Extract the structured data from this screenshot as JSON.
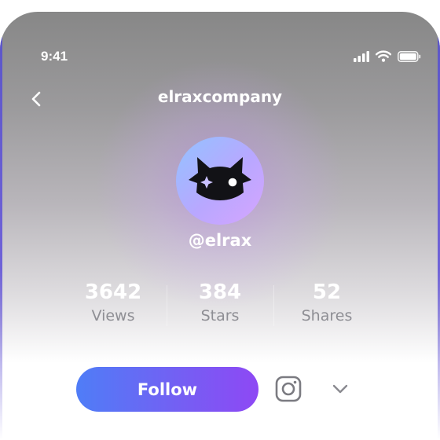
{
  "status_bar": {
    "time": "9:41"
  },
  "header": {
    "title": "elraxcompany"
  },
  "profile": {
    "handle": "@elrax"
  },
  "stats": [
    {
      "value": "3642",
      "label": "Views"
    },
    {
      "value": "384",
      "label": "Stars"
    },
    {
      "value": "52",
      "label": "Shares"
    }
  ],
  "actions": {
    "follow_label": "Follow"
  },
  "icons": {
    "back": "chevron-left-icon",
    "signal": "signal-icon",
    "wifi": "wifi-icon",
    "battery": "battery-icon",
    "avatar": "cat-mask-icon",
    "instagram": "instagram-icon",
    "more": "chevron-down-icon"
  },
  "colors": {
    "follow_start": "#4f7df7",
    "follow_end": "#8e48f4",
    "avatar_start": "#92c3ff",
    "avatar_end": "#d6a6ff"
  }
}
